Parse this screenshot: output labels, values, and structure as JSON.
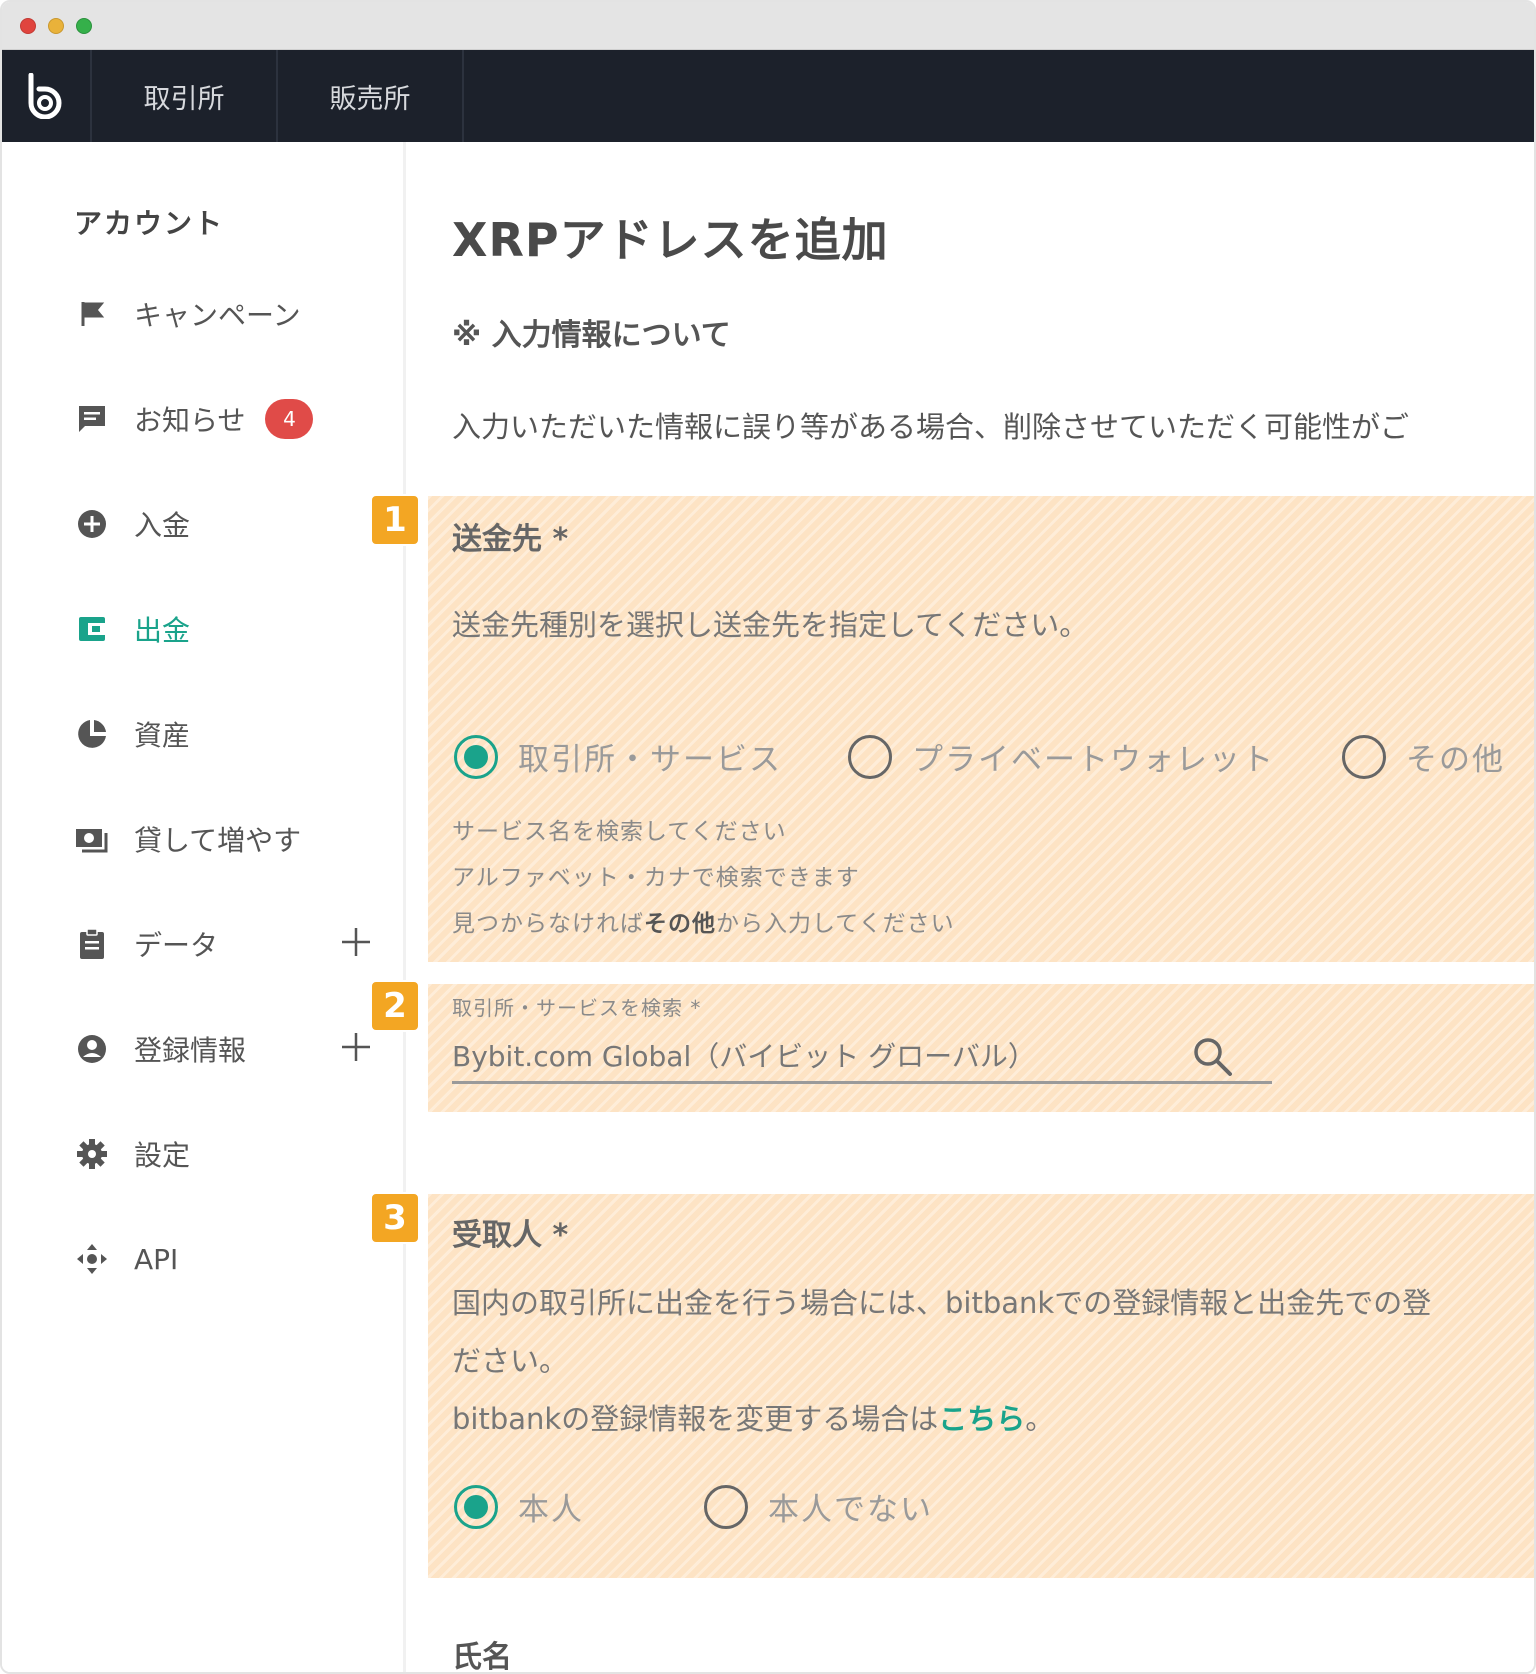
{
  "nav": {
    "tabs": [
      {
        "label": "取引所"
      },
      {
        "label": "販売所"
      }
    ]
  },
  "sidebar": {
    "title": "アカウント",
    "items": [
      {
        "label": "キャンペーン",
        "icon": "flag-icon"
      },
      {
        "label": "お知らせ",
        "icon": "message-icon",
        "badge": "4"
      },
      {
        "label": "入金",
        "icon": "plus-circle-icon"
      },
      {
        "label": "出金",
        "icon": "wallet-icon",
        "active": true
      },
      {
        "label": "資産",
        "icon": "pie-chart-icon"
      },
      {
        "label": "貸して増やす",
        "icon": "lending-icon"
      },
      {
        "label": "データ",
        "icon": "clipboard-icon",
        "expandable": true
      },
      {
        "label": "登録情報",
        "icon": "user-circle-icon",
        "expandable": true
      },
      {
        "label": "設定",
        "icon": "gear-icon"
      },
      {
        "label": "API",
        "icon": "api-icon"
      }
    ]
  },
  "main": {
    "title": "XRPアドレスを追加",
    "notice_heading": "※ 入力情報について",
    "notice_body": "入力いただいた情報に誤り等がある場合、削除させていただく可能性がご",
    "section1": {
      "badge": "1",
      "label": "送金先 *",
      "description": "送金先種別を選択し送金先を指定してください。",
      "options": [
        "取引所・サービス",
        "プライベートウォレット",
        "その他"
      ],
      "selected": 0,
      "hints": [
        "サービス名を検索してください",
        "アルファベット・カナで検索できます"
      ],
      "hint3_prefix": "見つからなければ",
      "hint3_bold": "その他",
      "hint3_suffix": "から入力してください"
    },
    "section2": {
      "badge": "2",
      "field_label": "取引所・サービスを検索 *",
      "field_value": "Bybit.com Global（バイビット グローバル）"
    },
    "section3": {
      "badge": "3",
      "label": "受取人 *",
      "line1": "国内の取引所に出金を行う場合には、bitbankでの登録情報と出金先での登",
      "line2": "ださい。",
      "line3_prefix": "bitbankの登録情報を変更する場合は",
      "line3_link": "こちら",
      "line3_suffix": "。",
      "options": [
        "本人",
        "本人でない"
      ],
      "selected": 0
    },
    "name_label": "氏名"
  },
  "colors": {
    "accent": "#1aa38b",
    "nav_bg": "#1c212b",
    "highlight": "#fde3c4",
    "badge_orange": "#f3a623",
    "notification_red": "#e04b48"
  }
}
